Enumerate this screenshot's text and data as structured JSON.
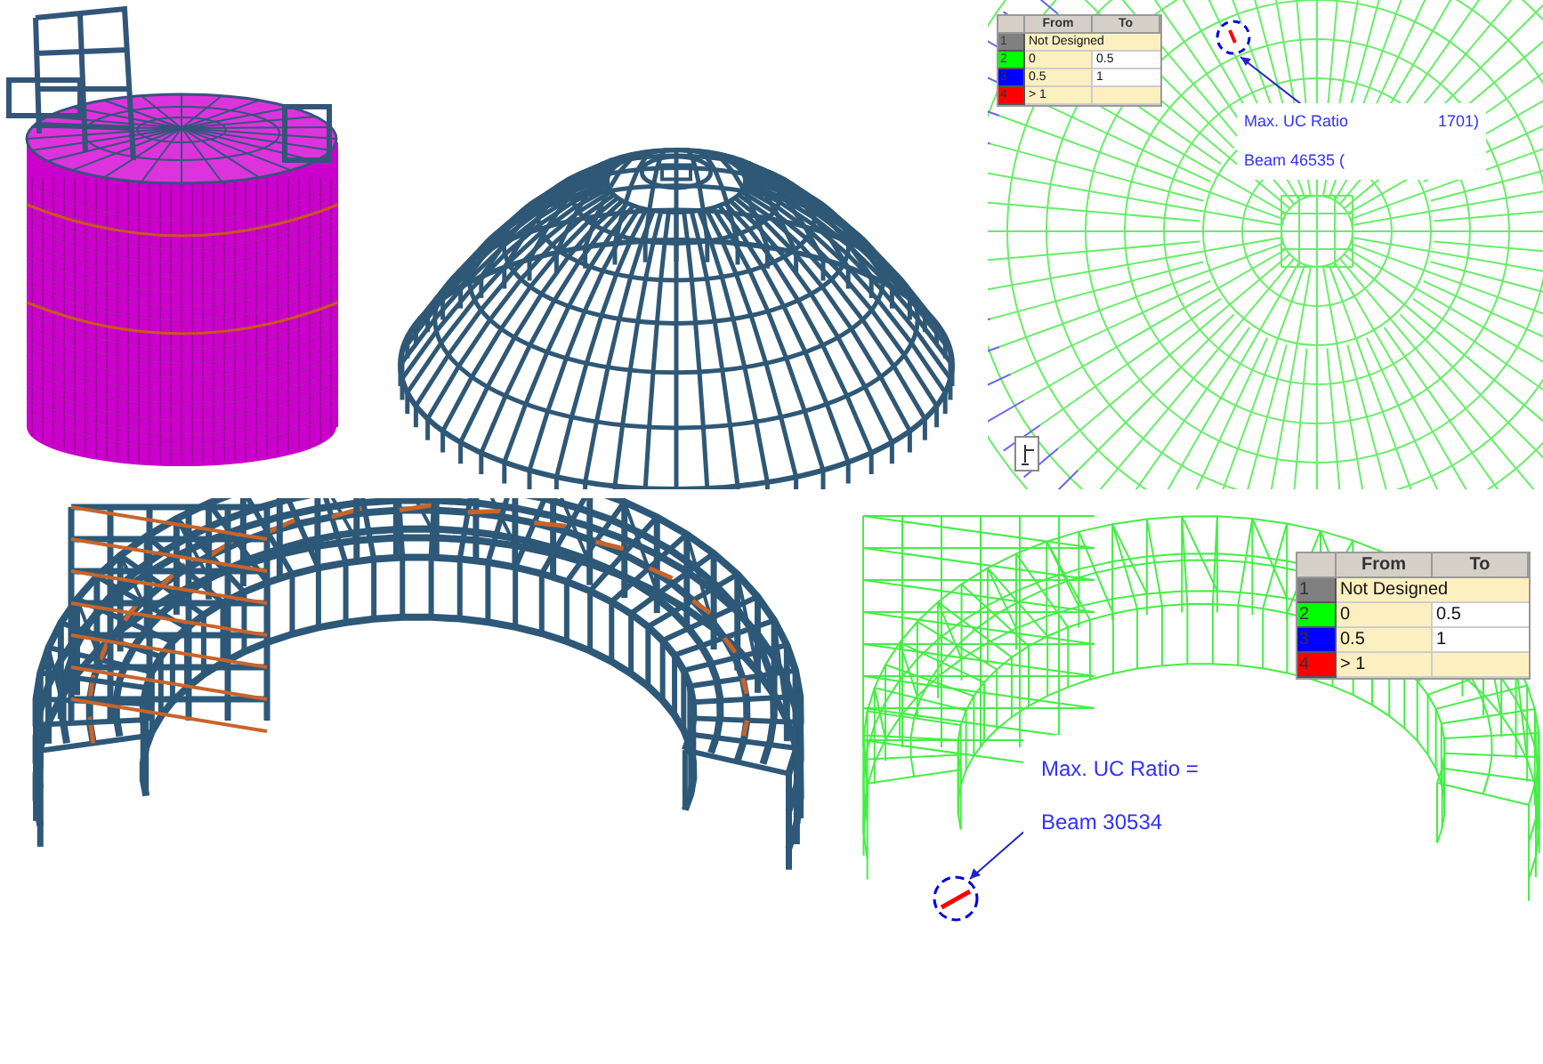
{
  "top_legend": {
    "columns": [
      "From",
      "To"
    ],
    "rows": [
      {
        "index": "1",
        "color": "#808080",
        "from": "Not Designed"
      },
      {
        "index": "2",
        "color": "#00ff00",
        "from": "0",
        "to": "0.5"
      },
      {
        "index": "3",
        "color": "#0000ff",
        "from": "0.5",
        "to": "1"
      },
      {
        "index": "4",
        "color": "#ff0000",
        "from": "> 1"
      }
    ]
  },
  "top_callout": {
    "lines": [
      [
        "Max. UC Ratio",
        "1701)"
      ],
      [
        "Beam 46535 ("
      ]
    ]
  },
  "bottom_legend": {
    "columns": [
      "From",
      "To"
    ],
    "rows": [
      {
        "index": "1",
        "color": "#808080",
        "from": "Not Designed"
      },
      {
        "index": "2",
        "color": "#00ff00",
        "from": "0",
        "to": "0.5"
      },
      {
        "index": "3",
        "color": "#0000ff",
        "from": "0.5",
        "to": "1"
      },
      {
        "index": "4",
        "color": "#ff0000",
        "from": "> 1"
      }
    ]
  },
  "bottom_callout": {
    "lines": [
      [
        "Max. UC Ratio ="
      ],
      [
        "Beam 30534"
      ]
    ]
  }
}
